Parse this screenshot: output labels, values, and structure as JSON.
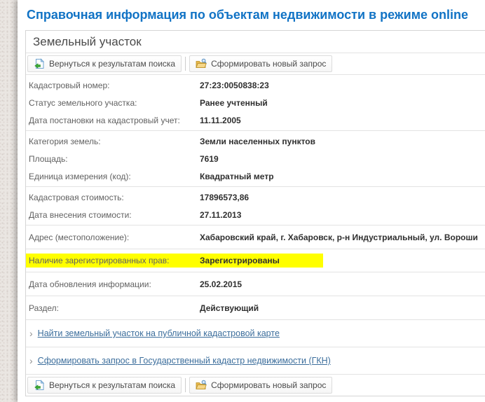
{
  "page": {
    "title": "Справочная информация по объектам недвижимости в режиме online"
  },
  "panel": {
    "title": "Земельный участок",
    "toolbar": {
      "back": "Вернуться к результатам поиска",
      "new_request": "Сформировать новый запрос"
    },
    "groups": [
      {
        "rows": [
          {
            "label": "Кадастровый номер:",
            "value": "27:23:0050838:23"
          },
          {
            "label": "Статус земельного участка:",
            "value": "Ранее учтенный"
          },
          {
            "label": "Дата постановки на кадастровый учет:",
            "value": "11.11.2005"
          }
        ]
      },
      {
        "rows": [
          {
            "label": "Категория земель:",
            "value": "Земли населенных пунктов"
          },
          {
            "label": "Площадь:",
            "value": "7619"
          },
          {
            "label": "Единица измерения (код):",
            "value": "Квадратный метр"
          }
        ]
      },
      {
        "rows": [
          {
            "label": "Кадастровая стоимость:",
            "value": "17896573,86"
          },
          {
            "label": "Дата внесения стоимости:",
            "value": "27.11.2013"
          }
        ]
      },
      {
        "rows": [
          {
            "label": "Адрес (местоположение):",
            "value": "Хабаровский край, г. Хабаровск, р-н Индустриальный, ул. Вороши"
          }
        ]
      },
      {
        "highlighted": true,
        "rows": [
          {
            "label": "Наличие зарегистрированных прав:",
            "value": "Зарегистрированы"
          }
        ]
      },
      {
        "rows": [
          {
            "label": "Дата обновления информации:",
            "value": "25.02.2015"
          }
        ]
      },
      {
        "rows": [
          {
            "label": "Раздел:",
            "value": "Действующий"
          }
        ]
      }
    ],
    "links": [
      {
        "label": "Найти земельный участок на публичной кадастровой карте"
      },
      {
        "label": "Сформировать запрос в Государственный кадастр недвижимости (ГКН)"
      }
    ]
  },
  "colors": {
    "title_blue": "#1173c5",
    "link_blue": "#3c6e9c",
    "highlight_yellow": "#ffff00",
    "label_gray": "#616161",
    "value_dark": "#2f2f2f"
  }
}
